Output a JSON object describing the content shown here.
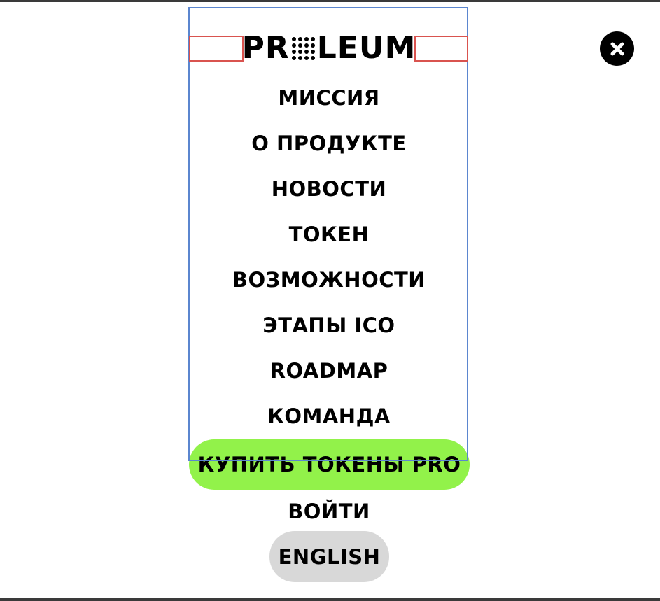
{
  "logo": {
    "left_text": "PR",
    "right_text": "LEUM",
    "icon": "dot-grid-o"
  },
  "close_icon": "close-icon",
  "menu": {
    "items": [
      {
        "label": "МИССИЯ"
      },
      {
        "label": "О ПРОДУКТЕ"
      },
      {
        "label": "НОВОСТИ"
      },
      {
        "label": "ТОКЕН"
      },
      {
        "label": "ВОЗМОЖНОСТИ"
      },
      {
        "label": "ЭТАПЫ ICO"
      },
      {
        "label": "ROADMAP"
      },
      {
        "label": "КОМАНДА"
      }
    ]
  },
  "buy_button": {
    "label": "КУПИТЬ ТОКЕНЫ PRO"
  },
  "login": {
    "label": "ВОЙТИ"
  },
  "language_button": {
    "label": "ENGLISH"
  },
  "colors": {
    "accent_green": "#92f24a",
    "language_bg": "#d8d8d8",
    "text": "#000000",
    "outline_blue": "#5b86cf",
    "outline_red": "#d9534f"
  }
}
